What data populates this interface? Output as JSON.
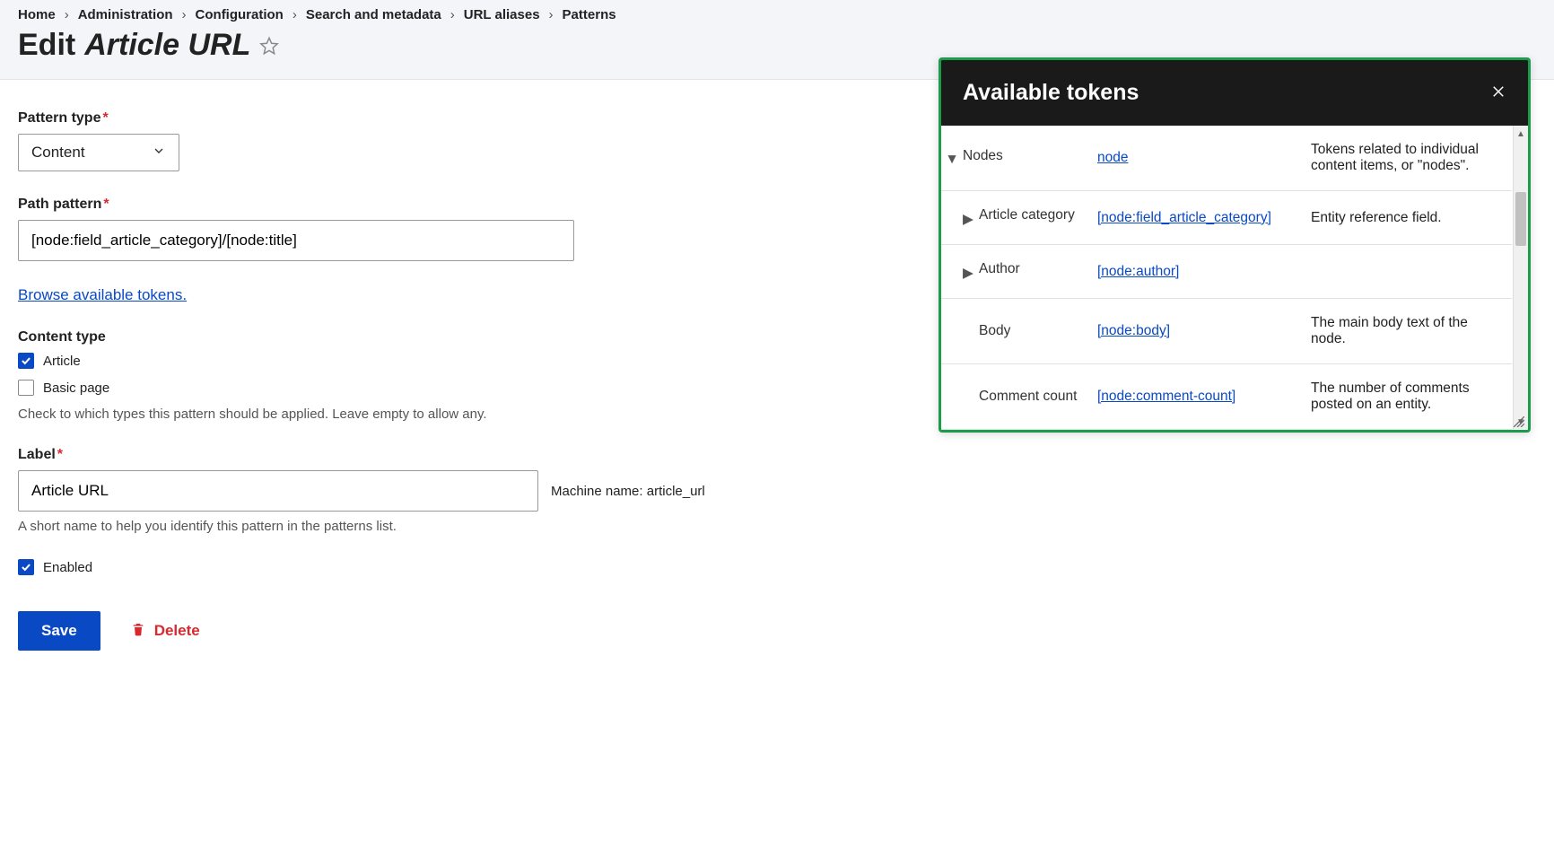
{
  "breadcrumb": [
    "Home",
    "Administration",
    "Configuration",
    "Search and metadata",
    "URL aliases",
    "Patterns"
  ],
  "page_title_prefix": "Edit",
  "page_title_italic": "Article URL",
  "form": {
    "pattern_type_label": "Pattern type",
    "pattern_type_value": "Content",
    "path_pattern_label": "Path pattern",
    "path_pattern_value": "[node:field_article_category]/[node:title]",
    "browse_tokens_link": "Browse available tokens.",
    "content_type_label": "Content type",
    "content_type_options": [
      {
        "label": "Article",
        "checked": true
      },
      {
        "label": "Basic page",
        "checked": false
      }
    ],
    "content_type_desc": "Check to which types this pattern should be applied. Leave empty to allow any.",
    "label_label": "Label",
    "label_value": "Article URL",
    "machine_name_prefix": "Machine name:",
    "machine_name_value": "article_url",
    "label_desc": "A short name to help you identify this pattern in the patterns list.",
    "enabled_label": "Enabled",
    "enabled_checked": true,
    "save_btn": "Save",
    "delete_btn": "Delete"
  },
  "dialog": {
    "title": "Available tokens",
    "rows": [
      {
        "depth": 0,
        "expand": "down",
        "name": "Nodes",
        "token": "node",
        "desc": "Tokens related to individual content items, or \"nodes\"."
      },
      {
        "depth": 1,
        "expand": "right",
        "name": "Article category",
        "token": "[node:field_article_category]",
        "desc": "Entity reference field."
      },
      {
        "depth": 1,
        "expand": "right",
        "name": "Author",
        "token": "[node:author]",
        "desc": ""
      },
      {
        "depth": 1,
        "expand": "none",
        "name": "Body",
        "token": "[node:body]",
        "desc": "The main body text of the node."
      },
      {
        "depth": 1,
        "expand": "none",
        "name": "Comment count",
        "token": "[node:comment-count]",
        "desc": "The number of comments posted on an entity."
      }
    ]
  }
}
